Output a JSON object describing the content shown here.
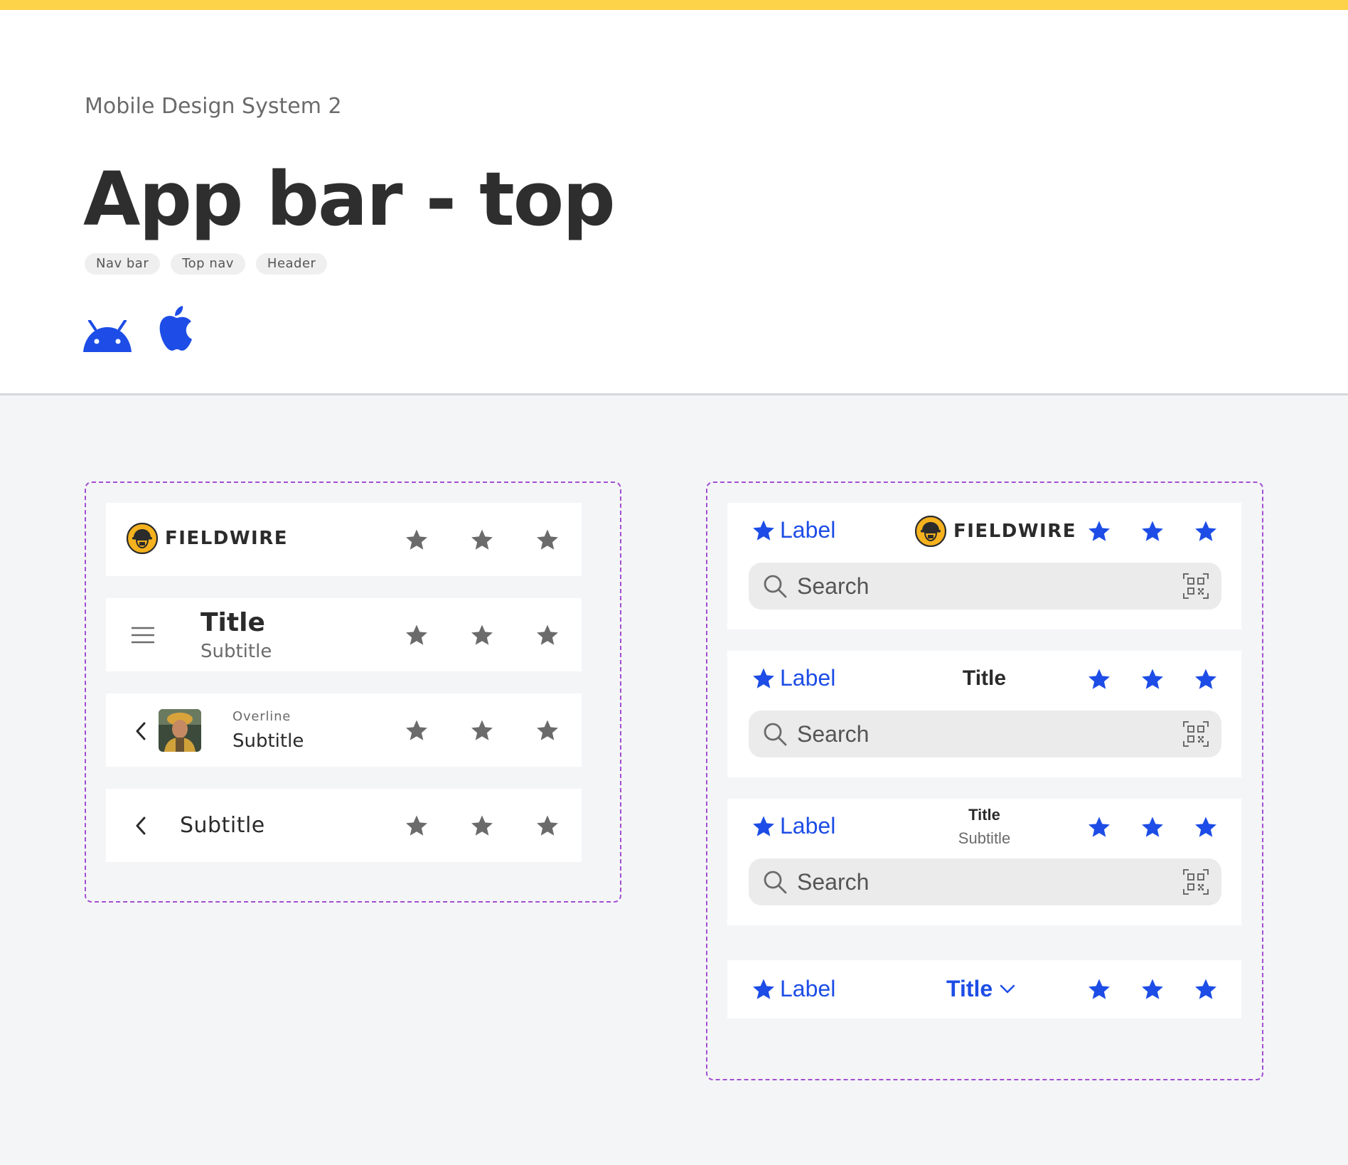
{
  "header": {
    "kicker": "Mobile Design System 2",
    "title": "App bar - top",
    "tags": [
      "Nav bar",
      "Top nav",
      "Header"
    ],
    "platforms": [
      "android-icon",
      "apple-icon"
    ]
  },
  "colors": {
    "accent_blue": "#1d4de6",
    "neutral_icon": "#6b6b6b",
    "frame_dash": "#a24fd1",
    "brand_yellow": "#fdd34a"
  },
  "android": {
    "brand": "FIELDWIRE",
    "bar2": {
      "title": "Title",
      "subtitle": "Subtitle"
    },
    "bar3": {
      "overline": "Overline",
      "subtitle": "Subtitle"
    },
    "bar4": {
      "subtitle": "Subtitle"
    }
  },
  "ios": {
    "label": "Label",
    "brand": "FIELDWIRE",
    "search_placeholder": "Search",
    "bar2": {
      "title": "Title"
    },
    "bar3": {
      "title": "Title",
      "subtitle": "Subtitle"
    },
    "bar4": {
      "title": "Title"
    }
  }
}
